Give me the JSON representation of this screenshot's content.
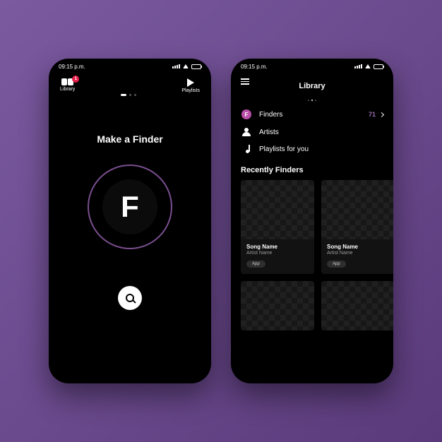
{
  "status": {
    "time": "09:15 p.m."
  },
  "screen1": {
    "library_label": "Library",
    "badge": "1",
    "playlists_label": "Playlists",
    "title": "Make a Finder",
    "logo_letter": "F"
  },
  "screen2": {
    "title": "Library",
    "finders": {
      "label": "Finders",
      "icon_letter": "F",
      "count": "71"
    },
    "artists_label": "Artists",
    "playlists_label": "Playlists for you",
    "section": "Recently Finders",
    "cards": [
      {
        "song": "Song Name",
        "artist": "Artist Name",
        "chip": "App"
      },
      {
        "song": "Song Name",
        "artist": "Artist Name",
        "chip": "App"
      }
    ]
  }
}
